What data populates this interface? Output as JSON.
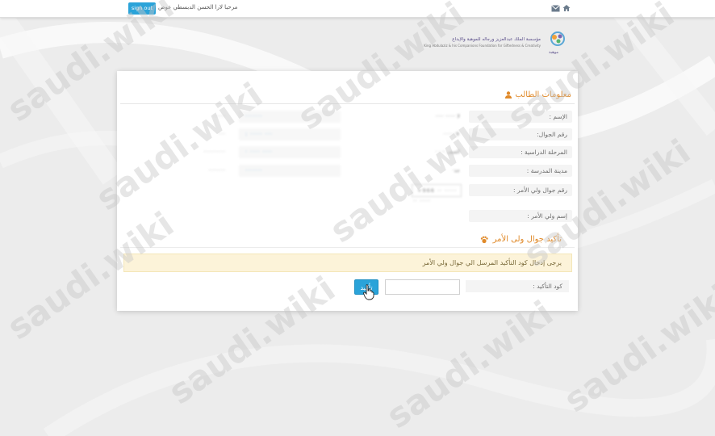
{
  "topbar": {
    "welcome_text": "مرحبا لارا الحسن الدبسطي عوض",
    "logout_label": "sign out",
    "home_icon": "home-icon",
    "mail_icon": "mail-icon"
  },
  "logo": {
    "line1": "مؤسسة الملك عبدالعزيز ورجاله للموهبة والإبداع",
    "line2": "King Abdulaziz & his Companions Foundation for Giftedness & Creativity",
    "caption": "موهبة"
  },
  "panel": {
    "title": "معلومات الطالب",
    "fields": {
      "name_label": "الإسم :",
      "name_value": "لا ······ ·····",
      "mobile_label": "رقم الجوال:",
      "mobile_value": "9·····",
      "stage_label": "المرحلة الدراسية :",
      "stage_value": "الصف ·· · ·",
      "city_label": "مدينة المدرسة :",
      "city_value": "جد·",
      "guardian_phone_label": "رقم جوال ولي الأمر :",
      "guardian_phone_value": "+966 ·· ·····",
      "guardian_name_label": "إسم ولي الأمر :",
      "guardian_name_value": "·· ·····",
      "left_col_values": [
        "·····",
        "···",
        "·········",
        "·······"
      ],
      "mid_col_values": [
        "·······",
        "··· ····· :",
        "···· ···· ·",
        "·······"
      ]
    },
    "confirm_section": {
      "title": "تأكيد جوال ولى الأمر",
      "alert_text": "يرجى إدخال كود التأكيد المرسل الي جوال ولي الأمر",
      "code_label": "كود التأكيد :",
      "code_value": "",
      "confirm_button": "تأكيد"
    }
  },
  "watermark_text": "saudi.wiki",
  "colors": {
    "accent": "#2aa3d9",
    "section_title": "#e08a2a",
    "alert_bg": "#fcf3d9"
  }
}
